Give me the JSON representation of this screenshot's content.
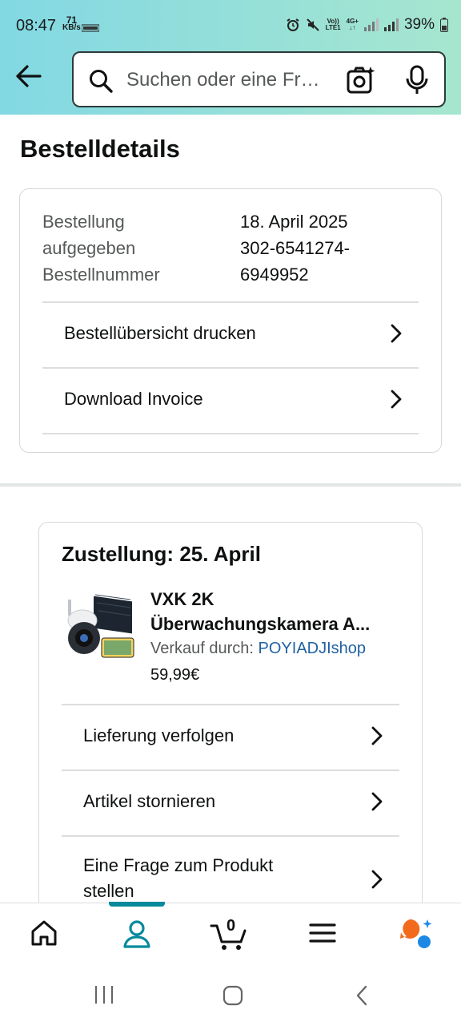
{
  "status_bar": {
    "time": "08:47",
    "speed_value": "71",
    "speed_unit": "KB/s",
    "network_top": "Vo))",
    "network_bottom": "LTE1",
    "network2_top": "4G+",
    "battery": "39%"
  },
  "search": {
    "placeholder": "Suchen oder eine Fr…"
  },
  "page": {
    "title": "Bestelldetails"
  },
  "order_info": {
    "labels": [
      "Bestellung",
      "aufgegeben",
      "Bestellnummer"
    ],
    "date": "18. April 2025",
    "number_line1": "302-6541274-",
    "number_line2": "6949952"
  },
  "order_actions": [
    {
      "label": "Bestellübersicht drucken"
    },
    {
      "label": "Download Invoice"
    }
  ],
  "shipment": {
    "title": "Zustellung: 25. April",
    "product": {
      "title_line1": "VXK 2K",
      "title_line2": "Überwachungskamera A...",
      "seller_prefix": "Verkauf durch:",
      "seller_name": "POYIADJIshop",
      "price": "59,99€"
    },
    "actions": [
      {
        "label": "Lieferung verfolgen"
      },
      {
        "label": "Artikel stornieren"
      },
      {
        "label": "Eine Frage zum Produkt stellen"
      }
    ]
  },
  "bottom_nav": {
    "cart_count": "0",
    "items": [
      "home-icon",
      "account-icon",
      "cart-icon",
      "menu-icon",
      "rufus-icon"
    ],
    "active_color": "#078a9c"
  },
  "colors": {
    "header_start": "#82d8e3",
    "header_end": "#a6e6cf",
    "link": "#2162a1"
  }
}
